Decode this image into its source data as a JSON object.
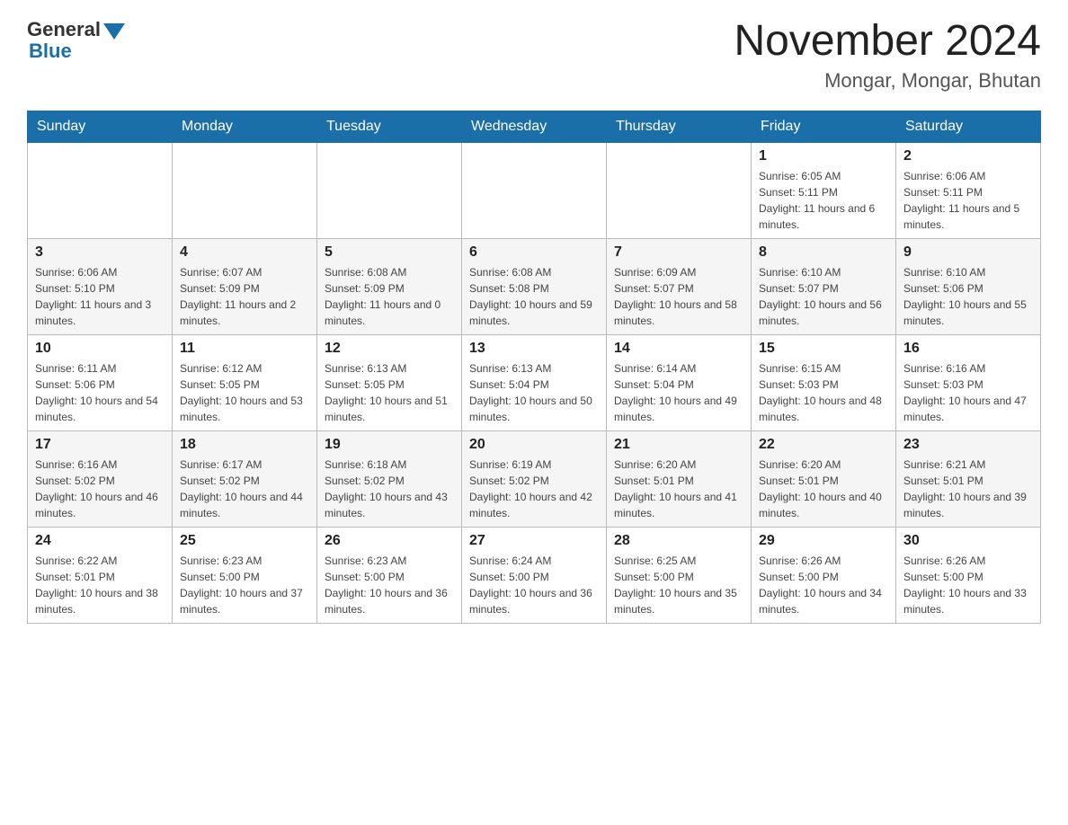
{
  "header": {
    "logo_text": "General",
    "logo_blue": "Blue",
    "month_title": "November 2024",
    "location": "Mongar, Mongar, Bhutan"
  },
  "weekdays": [
    "Sunday",
    "Monday",
    "Tuesday",
    "Wednesday",
    "Thursday",
    "Friday",
    "Saturday"
  ],
  "weeks": [
    {
      "days": [
        {
          "num": "",
          "info": ""
        },
        {
          "num": "",
          "info": ""
        },
        {
          "num": "",
          "info": ""
        },
        {
          "num": "",
          "info": ""
        },
        {
          "num": "",
          "info": ""
        },
        {
          "num": "1",
          "info": "Sunrise: 6:05 AM\nSunset: 5:11 PM\nDaylight: 11 hours and 6 minutes."
        },
        {
          "num": "2",
          "info": "Sunrise: 6:06 AM\nSunset: 5:11 PM\nDaylight: 11 hours and 5 minutes."
        }
      ]
    },
    {
      "days": [
        {
          "num": "3",
          "info": "Sunrise: 6:06 AM\nSunset: 5:10 PM\nDaylight: 11 hours and 3 minutes."
        },
        {
          "num": "4",
          "info": "Sunrise: 6:07 AM\nSunset: 5:09 PM\nDaylight: 11 hours and 2 minutes."
        },
        {
          "num": "5",
          "info": "Sunrise: 6:08 AM\nSunset: 5:09 PM\nDaylight: 11 hours and 0 minutes."
        },
        {
          "num": "6",
          "info": "Sunrise: 6:08 AM\nSunset: 5:08 PM\nDaylight: 10 hours and 59 minutes."
        },
        {
          "num": "7",
          "info": "Sunrise: 6:09 AM\nSunset: 5:07 PM\nDaylight: 10 hours and 58 minutes."
        },
        {
          "num": "8",
          "info": "Sunrise: 6:10 AM\nSunset: 5:07 PM\nDaylight: 10 hours and 56 minutes."
        },
        {
          "num": "9",
          "info": "Sunrise: 6:10 AM\nSunset: 5:06 PM\nDaylight: 10 hours and 55 minutes."
        }
      ]
    },
    {
      "days": [
        {
          "num": "10",
          "info": "Sunrise: 6:11 AM\nSunset: 5:06 PM\nDaylight: 10 hours and 54 minutes."
        },
        {
          "num": "11",
          "info": "Sunrise: 6:12 AM\nSunset: 5:05 PM\nDaylight: 10 hours and 53 minutes."
        },
        {
          "num": "12",
          "info": "Sunrise: 6:13 AM\nSunset: 5:05 PM\nDaylight: 10 hours and 51 minutes."
        },
        {
          "num": "13",
          "info": "Sunrise: 6:13 AM\nSunset: 5:04 PM\nDaylight: 10 hours and 50 minutes."
        },
        {
          "num": "14",
          "info": "Sunrise: 6:14 AM\nSunset: 5:04 PM\nDaylight: 10 hours and 49 minutes."
        },
        {
          "num": "15",
          "info": "Sunrise: 6:15 AM\nSunset: 5:03 PM\nDaylight: 10 hours and 48 minutes."
        },
        {
          "num": "16",
          "info": "Sunrise: 6:16 AM\nSunset: 5:03 PM\nDaylight: 10 hours and 47 minutes."
        }
      ]
    },
    {
      "days": [
        {
          "num": "17",
          "info": "Sunrise: 6:16 AM\nSunset: 5:02 PM\nDaylight: 10 hours and 46 minutes."
        },
        {
          "num": "18",
          "info": "Sunrise: 6:17 AM\nSunset: 5:02 PM\nDaylight: 10 hours and 44 minutes."
        },
        {
          "num": "19",
          "info": "Sunrise: 6:18 AM\nSunset: 5:02 PM\nDaylight: 10 hours and 43 minutes."
        },
        {
          "num": "20",
          "info": "Sunrise: 6:19 AM\nSunset: 5:02 PM\nDaylight: 10 hours and 42 minutes."
        },
        {
          "num": "21",
          "info": "Sunrise: 6:20 AM\nSunset: 5:01 PM\nDaylight: 10 hours and 41 minutes."
        },
        {
          "num": "22",
          "info": "Sunrise: 6:20 AM\nSunset: 5:01 PM\nDaylight: 10 hours and 40 minutes."
        },
        {
          "num": "23",
          "info": "Sunrise: 6:21 AM\nSunset: 5:01 PM\nDaylight: 10 hours and 39 minutes."
        }
      ]
    },
    {
      "days": [
        {
          "num": "24",
          "info": "Sunrise: 6:22 AM\nSunset: 5:01 PM\nDaylight: 10 hours and 38 minutes."
        },
        {
          "num": "25",
          "info": "Sunrise: 6:23 AM\nSunset: 5:00 PM\nDaylight: 10 hours and 37 minutes."
        },
        {
          "num": "26",
          "info": "Sunrise: 6:23 AM\nSunset: 5:00 PM\nDaylight: 10 hours and 36 minutes."
        },
        {
          "num": "27",
          "info": "Sunrise: 6:24 AM\nSunset: 5:00 PM\nDaylight: 10 hours and 36 minutes."
        },
        {
          "num": "28",
          "info": "Sunrise: 6:25 AM\nSunset: 5:00 PM\nDaylight: 10 hours and 35 minutes."
        },
        {
          "num": "29",
          "info": "Sunrise: 6:26 AM\nSunset: 5:00 PM\nDaylight: 10 hours and 34 minutes."
        },
        {
          "num": "30",
          "info": "Sunrise: 6:26 AM\nSunset: 5:00 PM\nDaylight: 10 hours and 33 minutes."
        }
      ]
    }
  ]
}
